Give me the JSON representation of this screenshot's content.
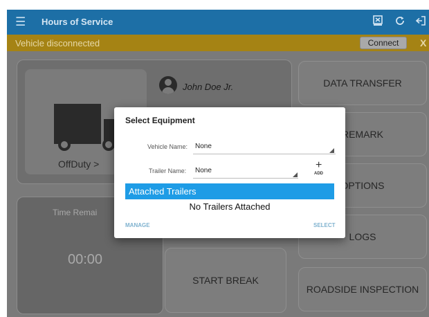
{
  "appbar": {
    "title": "Hours of Service",
    "menu_icon": "hamburger-menu-icon",
    "icons": [
      "export-icon",
      "refresh-icon",
      "logout-icon"
    ]
  },
  "banner": {
    "message": "Vehicle disconnected",
    "connect_label": "Connect",
    "close_label": "X"
  },
  "status": {
    "duty_label": "OffDuty",
    "chevron": ">",
    "driver_name": "John Doe Jr.",
    "time_label": "Time Remai",
    "time_value": "00:00"
  },
  "side_buttons": [
    {
      "label": "DATA TRANSFER"
    },
    {
      "label": "REMARK"
    },
    {
      "label": "OPTIONS"
    },
    {
      "label": "LOGS"
    },
    {
      "label": "ROADSIDE INSPECTION"
    }
  ],
  "center_buttons": {
    "start_break": "START BREAK"
  },
  "dialog": {
    "title": "Select Equipment",
    "vehicle_label": "Vehicle Name:",
    "vehicle_value": "None",
    "trailer_label": "Trailer Name:",
    "trailer_value": "None",
    "add_icon": "+",
    "add_label": "ADD",
    "attached_header": "Attached Trailers",
    "empty_message": "No Trailers Attached",
    "manage_label": "MANAGE",
    "select_label": "SELECT"
  },
  "colors": {
    "appbar": "#1d6fa6",
    "banner": "#a58314",
    "accent": "#1e9ce6",
    "dialog_action": "#7fb2cf"
  }
}
